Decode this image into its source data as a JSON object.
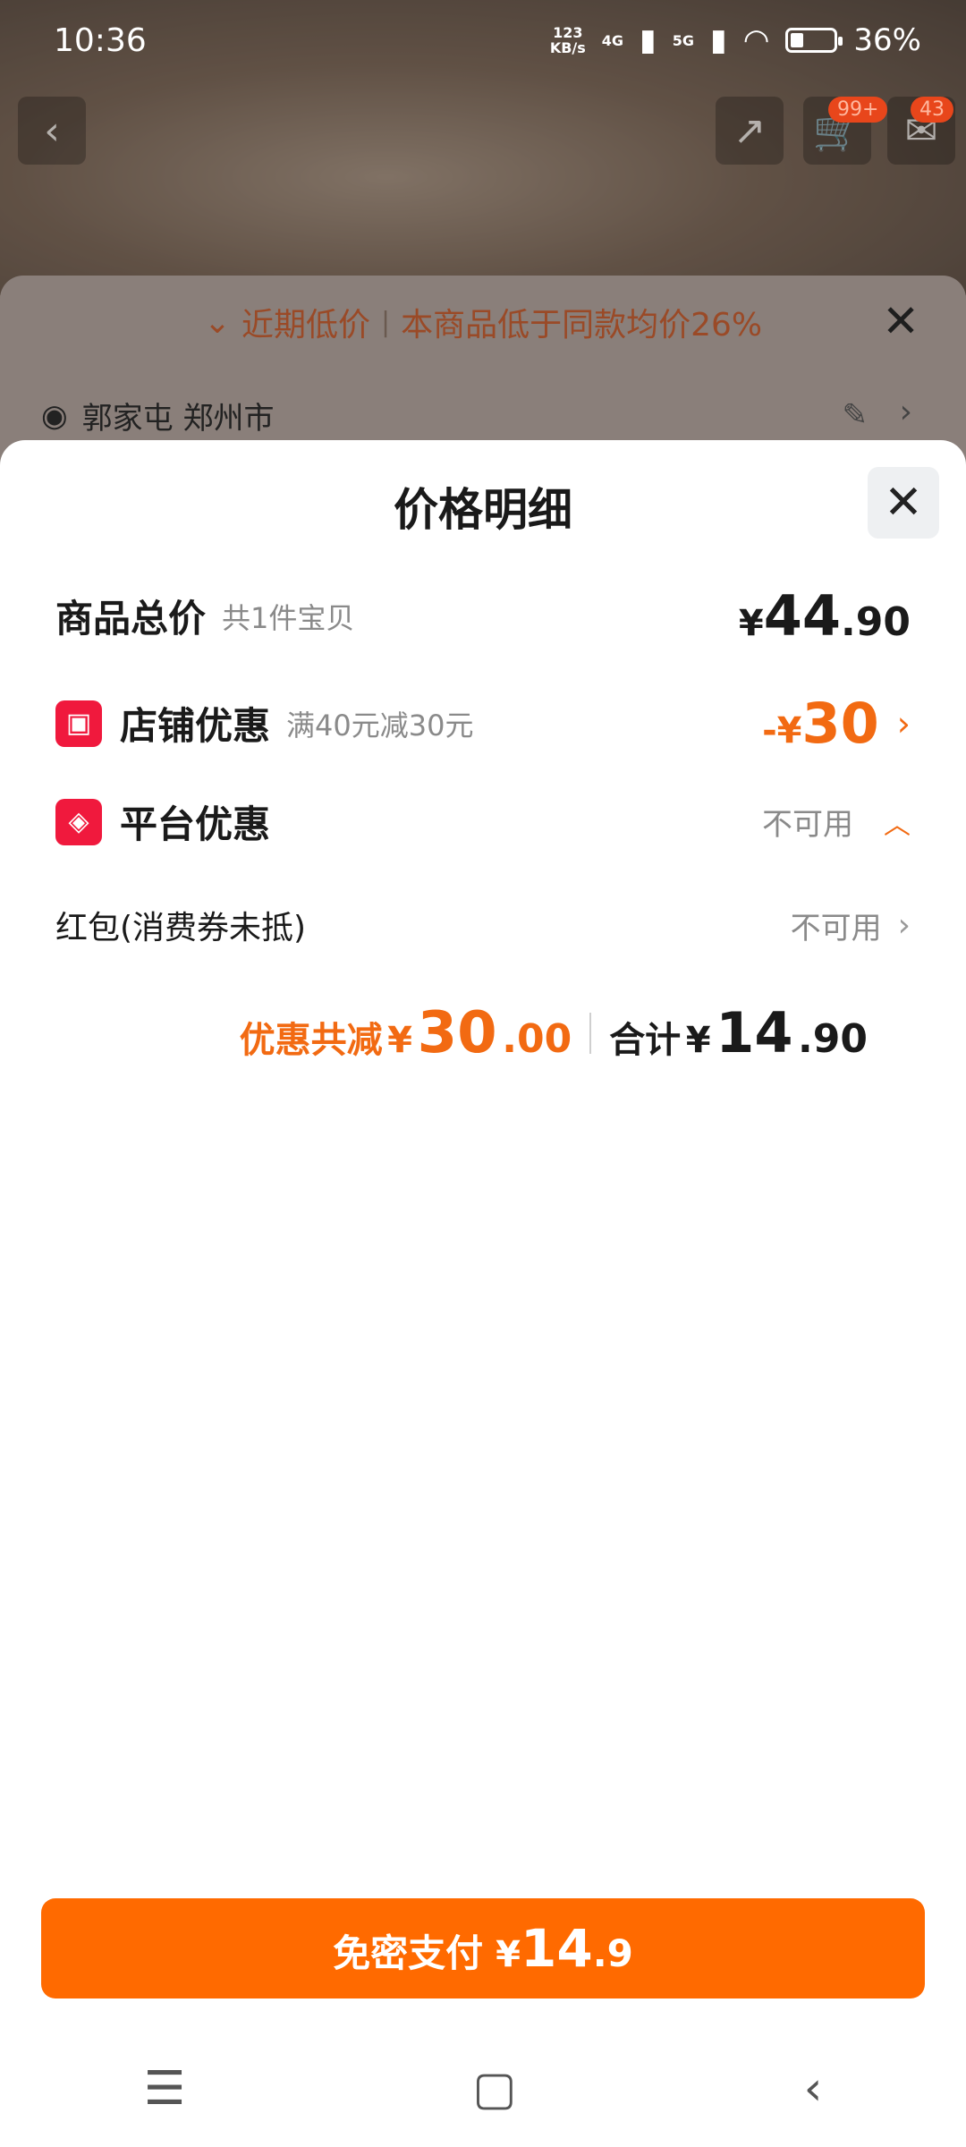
{
  "status_bar": {
    "time": "10:36",
    "net_speed_top": "123",
    "net_speed_bottom": "KB/s",
    "signal1": "4G",
    "signal2": "5G",
    "battery": "36%"
  },
  "top_actions": {
    "cart_badge": "99+",
    "msg_badge": "43"
  },
  "behind_sheet": {
    "low_price_tag": "近期低价",
    "low_price_text": "本商品低于同款均价26%",
    "address": "郭家屯 郑州市"
  },
  "price_detail": {
    "title": "价格明细",
    "total": {
      "label": "商品总价",
      "sub": "共1件宝贝",
      "yen": "¥",
      "int": "44",
      "dec": ".90"
    },
    "shop_discount": {
      "label": "店铺优惠",
      "sub": "满40元减30元",
      "minus": "-",
      "yen": "¥",
      "int": "30"
    },
    "platform_discount": {
      "label": "平台优惠",
      "status": "不可用"
    },
    "red_packet": {
      "label": "红包(消费券未抵)",
      "status": "不可用"
    },
    "summary": {
      "discount_label": "优惠共减",
      "discount_yen": "¥",
      "discount_int": "30",
      "discount_dec": ".00",
      "sum_label": "合计",
      "sum_yen": "¥",
      "sum_int": "14",
      "sum_dec": ".90"
    }
  },
  "pay_button": {
    "label": "免密支付",
    "yen": "¥",
    "int": "14",
    "dec": ".9"
  },
  "nav": {
    "menu": "☰",
    "home": "▢",
    "back": "‹"
  },
  "colors": {
    "accent": "#ff6a00",
    "discount": "#f26a12",
    "icon_red": "#f0193d"
  }
}
